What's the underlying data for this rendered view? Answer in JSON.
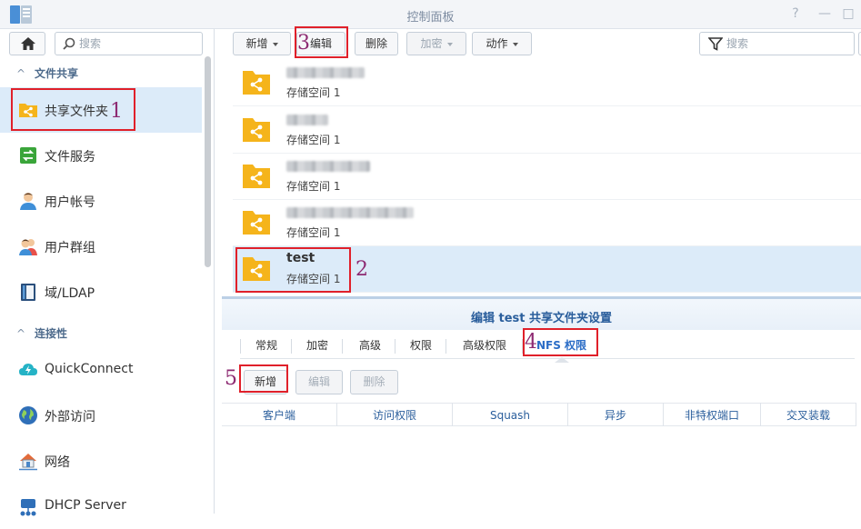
{
  "window": {
    "title": "控制面板",
    "controls": [
      "?",
      "—",
      "□"
    ]
  },
  "left": {
    "search_placeholder": "搜索",
    "sections": [
      {
        "label": "文件共享"
      },
      {
        "label": "连接性"
      }
    ],
    "items": [
      {
        "label": "共享文件夹"
      },
      {
        "label": "文件服务"
      },
      {
        "label": "用户帐号"
      },
      {
        "label": "用户群组"
      },
      {
        "label": "域/LDAP"
      },
      {
        "label": "QuickConnect"
      },
      {
        "label": "外部访问"
      },
      {
        "label": "网络"
      },
      {
        "label": "DHCP Server"
      }
    ]
  },
  "toolbar": {
    "create": "新增",
    "edit": "编辑",
    "delete": "删除",
    "encrypt": "加密",
    "action": "动作",
    "search_placeholder": "搜索"
  },
  "folders": [
    {
      "name": "",
      "storage": "存储空间 1"
    },
    {
      "name": "",
      "storage": "存储空间 1"
    },
    {
      "name": "",
      "storage": "存储空间 1"
    },
    {
      "name": "",
      "storage": "存储空间 1"
    },
    {
      "name": "test",
      "storage": "存储空间 1"
    }
  ],
  "dialog": {
    "title": "编辑 test 共享文件夹设置",
    "tabs": [
      "常规",
      "加密",
      "高级",
      "权限",
      "高级权限",
      "NFS 权限"
    ],
    "buttons": {
      "create": "新增",
      "edit": "编辑",
      "delete": "删除"
    },
    "columns": [
      "客户端",
      "访问权限",
      "Squash",
      "异步",
      "非特权端口",
      "交叉装载"
    ]
  },
  "annotations": [
    "1",
    "2",
    "3",
    "4",
    "5"
  ],
  "colors": {
    "accent": "#2a6cc6",
    "selected_bg": "#dcebf9",
    "folder": "#f5b41b",
    "annotation_box": "#e0202a",
    "annotation_number": "#8d2a72"
  }
}
